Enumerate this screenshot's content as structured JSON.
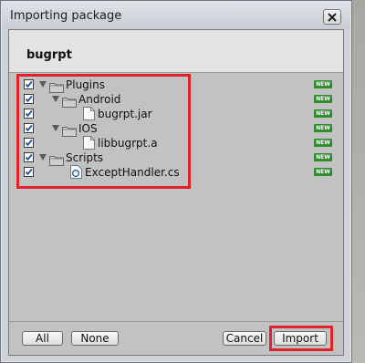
{
  "window": {
    "title": "Importing package"
  },
  "package": {
    "name": "bugrpt"
  },
  "tree": [
    {
      "label": "Plugins",
      "type": "folder",
      "depth": 0,
      "checked": true,
      "badge": "NEW"
    },
    {
      "label": "Android",
      "type": "folder",
      "depth": 1,
      "checked": true,
      "badge": "NEW"
    },
    {
      "label": "bugrpt.jar",
      "type": "file",
      "depth": 2,
      "checked": true,
      "badge": "NEW"
    },
    {
      "label": "IOS",
      "type": "folder",
      "depth": 1,
      "checked": true,
      "badge": "NEW"
    },
    {
      "label": "libbugrpt.a",
      "type": "file",
      "depth": 2,
      "checked": true,
      "badge": "NEW"
    },
    {
      "label": "Scripts",
      "type": "folder",
      "depth": 0,
      "checked": true,
      "badge": "NEW"
    },
    {
      "label": "ExceptHandler.cs",
      "type": "script",
      "depth": 1,
      "checked": true,
      "badge": "NEW"
    }
  ],
  "buttons": {
    "all": "All",
    "none": "None",
    "cancel": "Cancel",
    "import": "Import"
  },
  "colors": {
    "highlight": "#e0232a",
    "badge": "#2e8b2e"
  }
}
